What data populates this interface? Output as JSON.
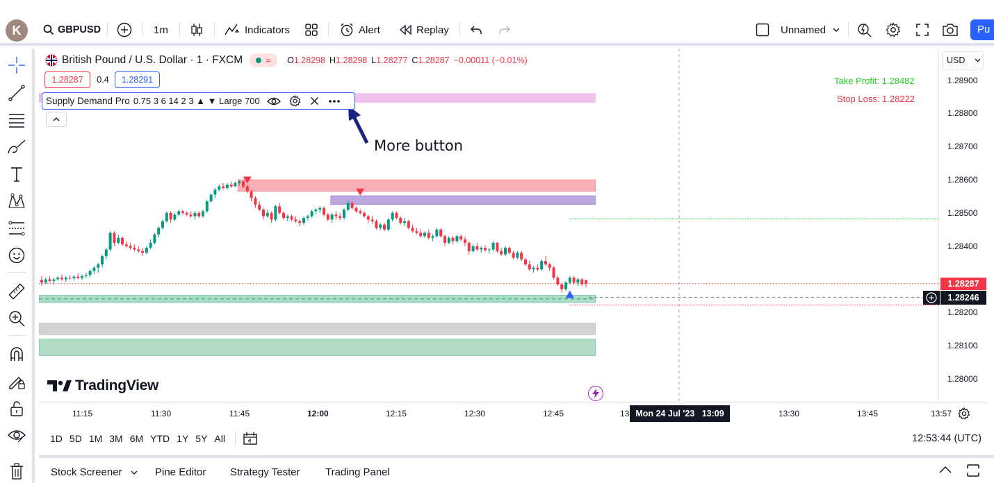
{
  "toolbar": {
    "avatar_letter": "K",
    "symbol": "GBPUSD",
    "interval": "1m",
    "indicators_label": "Indicators",
    "alert_label": "Alert",
    "replay_label": "Replay",
    "layout_name": "Unnamed",
    "publish_label": "Pu"
  },
  "legend": {
    "title": "British Pound / U.S. Dollar · 1 · FXCM",
    "open_label": "O",
    "open": "1.28298",
    "high_label": "H",
    "high": "1.28298",
    "low_label": "L",
    "low": "1.28277",
    "close_label": "C",
    "close": "1.28287",
    "change": "−0.00011 (−0.01%)",
    "bid": "1.28287",
    "spread": "0.4",
    "ask": "1.28291"
  },
  "indicator": {
    "name": "Supply Demand Pro",
    "params": "0.75 3 6 14 2 3 ▲ ▼ Large 700"
  },
  "annotation": {
    "more_button_label": "More button"
  },
  "overlay": {
    "take_profit": "Take Profit: 1.28482",
    "stop_loss": "Stop Loss: 1.28222",
    "watermark": "TradingView"
  },
  "price_scale": {
    "currency": "USD",
    "labels": [
      "1.28900",
      "1.28800",
      "1.28700",
      "1.28600",
      "1.28500",
      "1.28400",
      "1.28200",
      "1.28100",
      "1.28000"
    ],
    "last_price": "1.28287",
    "crosshair_price": "1.28246"
  },
  "time_scale": {
    "labels": [
      "11:15",
      "11:30",
      "11:45",
      "12:00",
      "12:15",
      "12:30",
      "12:45",
      "13",
      "13:30",
      "13:45",
      "13:57"
    ],
    "crosshair_time": "Mon 24 Jul '23   13:09"
  },
  "range_bar": {
    "ranges": [
      "1D",
      "5D",
      "1M",
      "3M",
      "6M",
      "YTD",
      "1Y",
      "5Y",
      "All"
    ],
    "clock": "12:53:44 (UTC)"
  },
  "bottom_tabs": [
    "Stock Screener",
    "Pine Editor",
    "Strategy Tester",
    "Trading Panel"
  ],
  "colors": {
    "bull": "#089981",
    "bear": "#f23645",
    "accent": "#2962ff",
    "supply_zone": "#f7a1a9",
    "purple_zone": "#b39ddb",
    "demand_zone": "#a5d6b8",
    "neutral_zone": "#c9cacd",
    "pink_zone": "#f0b6ea"
  },
  "chart_data": {
    "type": "candlestick",
    "interval": "1m",
    "ylim": [
      1.2797,
      1.2895
    ],
    "candles": [
      {
        "o": 1.28298,
        "h": 1.2831,
        "l": 1.2828,
        "c": 1.2829
      },
      {
        "o": 1.2829,
        "h": 1.28305,
        "l": 1.28285,
        "c": 1.283
      },
      {
        "o": 1.283,
        "h": 1.2831,
        "l": 1.2829,
        "c": 1.28295
      },
      {
        "o": 1.28295,
        "h": 1.28305,
        "l": 1.28285,
        "c": 1.283
      },
      {
        "o": 1.283,
        "h": 1.2831,
        "l": 1.28295,
        "c": 1.28305
      },
      {
        "o": 1.28305,
        "h": 1.28315,
        "l": 1.28295,
        "c": 1.283
      },
      {
        "o": 1.283,
        "h": 1.2831,
        "l": 1.28292,
        "c": 1.28305
      },
      {
        "o": 1.28305,
        "h": 1.28312,
        "l": 1.28298,
        "c": 1.28303
      },
      {
        "o": 1.28303,
        "h": 1.28312,
        "l": 1.28296,
        "c": 1.28308
      },
      {
        "o": 1.28308,
        "h": 1.28318,
        "l": 1.283,
        "c": 1.28304
      },
      {
        "o": 1.28304,
        "h": 1.28314,
        "l": 1.28298,
        "c": 1.2831
      },
      {
        "o": 1.2831,
        "h": 1.2832,
        "l": 1.28303,
        "c": 1.28313
      },
      {
        "o": 1.28313,
        "h": 1.2833,
        "l": 1.28305,
        "c": 1.28325
      },
      {
        "o": 1.28325,
        "h": 1.2834,
        "l": 1.28315,
        "c": 1.28335
      },
      {
        "o": 1.28335,
        "h": 1.2835,
        "l": 1.2832,
        "c": 1.28345
      },
      {
        "o": 1.28345,
        "h": 1.28375,
        "l": 1.28335,
        "c": 1.2837
      },
      {
        "o": 1.2837,
        "h": 1.28395,
        "l": 1.2836,
        "c": 1.2839
      },
      {
        "o": 1.2839,
        "h": 1.28445,
        "l": 1.28385,
        "c": 1.2844
      },
      {
        "o": 1.2844,
        "h": 1.28445,
        "l": 1.284,
        "c": 1.2841
      },
      {
        "o": 1.2841,
        "h": 1.28435,
        "l": 1.28405,
        "c": 1.28425
      },
      {
        "o": 1.28425,
        "h": 1.2843,
        "l": 1.284,
        "c": 1.28405
      },
      {
        "o": 1.28405,
        "h": 1.28415,
        "l": 1.28395,
        "c": 1.284
      },
      {
        "o": 1.284,
        "h": 1.2841,
        "l": 1.2839,
        "c": 1.28395
      },
      {
        "o": 1.28395,
        "h": 1.28405,
        "l": 1.28385,
        "c": 1.2839
      },
      {
        "o": 1.2839,
        "h": 1.284,
        "l": 1.2838,
        "c": 1.28385
      },
      {
        "o": 1.28385,
        "h": 1.28395,
        "l": 1.2837,
        "c": 1.2838
      },
      {
        "o": 1.2838,
        "h": 1.284,
        "l": 1.28375,
        "c": 1.28395
      },
      {
        "o": 1.28395,
        "h": 1.2842,
        "l": 1.2839,
        "c": 1.2841
      },
      {
        "o": 1.2841,
        "h": 1.2844,
        "l": 1.28405,
        "c": 1.28435
      },
      {
        "o": 1.28435,
        "h": 1.2846,
        "l": 1.28425,
        "c": 1.28455
      },
      {
        "o": 1.28455,
        "h": 1.2848,
        "l": 1.2845,
        "c": 1.28475
      },
      {
        "o": 1.28475,
        "h": 1.28505,
        "l": 1.2847,
        "c": 1.285
      },
      {
        "o": 1.285,
        "h": 1.28505,
        "l": 1.2847,
        "c": 1.2848
      },
      {
        "o": 1.2848,
        "h": 1.285,
        "l": 1.28475,
        "c": 1.28495
      },
      {
        "o": 1.28495,
        "h": 1.2851,
        "l": 1.2849,
        "c": 1.28505
      },
      {
        "o": 1.28505,
        "h": 1.2851,
        "l": 1.28495,
        "c": 1.285
      },
      {
        "o": 1.285,
        "h": 1.28505,
        "l": 1.2849,
        "c": 1.28495
      },
      {
        "o": 1.28495,
        "h": 1.28505,
        "l": 1.28485,
        "c": 1.2849
      },
      {
        "o": 1.2849,
        "h": 1.28505,
        "l": 1.2848,
        "c": 1.285
      },
      {
        "o": 1.285,
        "h": 1.28505,
        "l": 1.28485,
        "c": 1.2849
      },
      {
        "o": 1.2849,
        "h": 1.2851,
        "l": 1.28485,
        "c": 1.28505
      },
      {
        "o": 1.28505,
        "h": 1.2854,
        "l": 1.285,
        "c": 1.28535
      },
      {
        "o": 1.28535,
        "h": 1.2856,
        "l": 1.2853,
        "c": 1.28555
      },
      {
        "o": 1.28555,
        "h": 1.28575,
        "l": 1.28545,
        "c": 1.2857
      },
      {
        "o": 1.2857,
        "h": 1.28585,
        "l": 1.28565,
        "c": 1.2858
      },
      {
        "o": 1.2858,
        "h": 1.2859,
        "l": 1.2857,
        "c": 1.28575
      },
      {
        "o": 1.28575,
        "h": 1.2859,
        "l": 1.2857,
        "c": 1.28585
      },
      {
        "o": 1.28585,
        "h": 1.28595,
        "l": 1.28575,
        "c": 1.2858
      },
      {
        "o": 1.2858,
        "h": 1.28595,
        "l": 1.28578,
        "c": 1.2859
      },
      {
        "o": 1.2859,
        "h": 1.286,
        "l": 1.28582,
        "c": 1.28595
      },
      {
        "o": 1.28595,
        "h": 1.28598,
        "l": 1.28575,
        "c": 1.2858
      },
      {
        "o": 1.2858,
        "h": 1.28585,
        "l": 1.2856,
        "c": 1.28565
      },
      {
        "o": 1.28565,
        "h": 1.2857,
        "l": 1.28535,
        "c": 1.28545
      },
      {
        "o": 1.28545,
        "h": 1.2855,
        "l": 1.28515,
        "c": 1.28525
      },
      {
        "o": 1.28525,
        "h": 1.28535,
        "l": 1.28505,
        "c": 1.2851
      },
      {
        "o": 1.2851,
        "h": 1.28515,
        "l": 1.2848,
        "c": 1.2849
      },
      {
        "o": 1.2849,
        "h": 1.2851,
        "l": 1.28485,
        "c": 1.285
      },
      {
        "o": 1.285,
        "h": 1.28505,
        "l": 1.2847,
        "c": 1.2848
      },
      {
        "o": 1.2848,
        "h": 1.28525,
        "l": 1.28475,
        "c": 1.2852
      },
      {
        "o": 1.2852,
        "h": 1.2853,
        "l": 1.28495,
        "c": 1.285
      },
      {
        "o": 1.285,
        "h": 1.28505,
        "l": 1.2848,
        "c": 1.28485
      },
      {
        "o": 1.28485,
        "h": 1.28495,
        "l": 1.28475,
        "c": 1.2849
      },
      {
        "o": 1.2849,
        "h": 1.28495,
        "l": 1.28475,
        "c": 1.2848
      },
      {
        "o": 1.2848,
        "h": 1.2849,
        "l": 1.2847,
        "c": 1.28475
      },
      {
        "o": 1.28475,
        "h": 1.2848,
        "l": 1.2846,
        "c": 1.2847
      },
      {
        "o": 1.2847,
        "h": 1.2849,
        "l": 1.28465,
        "c": 1.28485
      },
      {
        "o": 1.28485,
        "h": 1.28495,
        "l": 1.28478,
        "c": 1.2849
      },
      {
        "o": 1.2849,
        "h": 1.2851,
        "l": 1.28485,
        "c": 1.28505
      },
      {
        "o": 1.28505,
        "h": 1.28515,
        "l": 1.28495,
        "c": 1.2851
      },
      {
        "o": 1.2851,
        "h": 1.2852,
        "l": 1.285,
        "c": 1.28515
      },
      {
        "o": 1.28515,
        "h": 1.2852,
        "l": 1.2849,
        "c": 1.28495
      },
      {
        "o": 1.28495,
        "h": 1.285,
        "l": 1.28475,
        "c": 1.2848
      },
      {
        "o": 1.2848,
        "h": 1.285,
        "l": 1.2847,
        "c": 1.28495
      },
      {
        "o": 1.28495,
        "h": 1.28505,
        "l": 1.2848,
        "c": 1.2849
      },
      {
        "o": 1.2849,
        "h": 1.285,
        "l": 1.28478,
        "c": 1.28485
      },
      {
        "o": 1.28485,
        "h": 1.28515,
        "l": 1.2848,
        "c": 1.2851
      },
      {
        "o": 1.2851,
        "h": 1.28535,
        "l": 1.28505,
        "c": 1.2853
      },
      {
        "o": 1.2853,
        "h": 1.28535,
        "l": 1.2851,
        "c": 1.28515
      },
      {
        "o": 1.28515,
        "h": 1.2852,
        "l": 1.285,
        "c": 1.28505
      },
      {
        "o": 1.28505,
        "h": 1.28512,
        "l": 1.28495,
        "c": 1.285
      },
      {
        "o": 1.285,
        "h": 1.28505,
        "l": 1.28485,
        "c": 1.2849
      },
      {
        "o": 1.2849,
        "h": 1.28495,
        "l": 1.2847,
        "c": 1.2848
      },
      {
        "o": 1.2848,
        "h": 1.2849,
        "l": 1.28468,
        "c": 1.28475
      },
      {
        "o": 1.28475,
        "h": 1.2848,
        "l": 1.2845,
        "c": 1.28455
      },
      {
        "o": 1.28455,
        "h": 1.2847,
        "l": 1.28448,
        "c": 1.28465
      },
      {
        "o": 1.28465,
        "h": 1.2847,
        "l": 1.28445,
        "c": 1.2845
      },
      {
        "o": 1.2845,
        "h": 1.28485,
        "l": 1.28445,
        "c": 1.2848
      },
      {
        "o": 1.2848,
        "h": 1.28505,
        "l": 1.28475,
        "c": 1.285
      },
      {
        "o": 1.285,
        "h": 1.28505,
        "l": 1.2848,
        "c": 1.28485
      },
      {
        "o": 1.28485,
        "h": 1.2849,
        "l": 1.28465,
        "c": 1.2847
      },
      {
        "o": 1.2847,
        "h": 1.28485,
        "l": 1.2846,
        "c": 1.28475
      },
      {
        "o": 1.28475,
        "h": 1.2848,
        "l": 1.2845,
        "c": 1.28455
      },
      {
        "o": 1.28455,
        "h": 1.28465,
        "l": 1.2844,
        "c": 1.28445
      },
      {
        "o": 1.28445,
        "h": 1.28455,
        "l": 1.28435,
        "c": 1.2844
      },
      {
        "o": 1.2844,
        "h": 1.2845,
        "l": 1.28425,
        "c": 1.2843
      },
      {
        "o": 1.2843,
        "h": 1.28445,
        "l": 1.28425,
        "c": 1.2844
      },
      {
        "o": 1.2844,
        "h": 1.2845,
        "l": 1.2842,
        "c": 1.28425
      },
      {
        "o": 1.28425,
        "h": 1.28435,
        "l": 1.28415,
        "c": 1.2843
      },
      {
        "o": 1.2843,
        "h": 1.28455,
        "l": 1.28425,
        "c": 1.2845
      },
      {
        "o": 1.2845,
        "h": 1.28455,
        "l": 1.28425,
        "c": 1.2843
      },
      {
        "o": 1.2843,
        "h": 1.28435,
        "l": 1.284,
        "c": 1.2841
      },
      {
        "o": 1.2841,
        "h": 1.2843,
        "l": 1.28405,
        "c": 1.28425
      },
      {
        "o": 1.28425,
        "h": 1.2843,
        "l": 1.28405,
        "c": 1.28415
      },
      {
        "o": 1.28415,
        "h": 1.28435,
        "l": 1.2841,
        "c": 1.2843
      },
      {
        "o": 1.2843,
        "h": 1.28435,
        "l": 1.28415,
        "c": 1.2842
      },
      {
        "o": 1.2842,
        "h": 1.28428,
        "l": 1.284,
        "c": 1.2841
      },
      {
        "o": 1.2841,
        "h": 1.28415,
        "l": 1.28375,
        "c": 1.28385
      },
      {
        "o": 1.28385,
        "h": 1.28405,
        "l": 1.2838,
        "c": 1.284
      },
      {
        "o": 1.284,
        "h": 1.2841,
        "l": 1.28385,
        "c": 1.2839
      },
      {
        "o": 1.2839,
        "h": 1.284,
        "l": 1.2838,
        "c": 1.28395
      },
      {
        "o": 1.28395,
        "h": 1.28402,
        "l": 1.28382,
        "c": 1.28388
      },
      {
        "o": 1.28388,
        "h": 1.28395,
        "l": 1.28378,
        "c": 1.2839
      },
      {
        "o": 1.2839,
        "h": 1.28415,
        "l": 1.28385,
        "c": 1.2841
      },
      {
        "o": 1.2841,
        "h": 1.28412,
        "l": 1.2838,
        "c": 1.28385
      },
      {
        "o": 1.28385,
        "h": 1.28395,
        "l": 1.2837,
        "c": 1.28375
      },
      {
        "o": 1.28375,
        "h": 1.284,
        "l": 1.2837,
        "c": 1.28395
      },
      {
        "o": 1.28395,
        "h": 1.284,
        "l": 1.28375,
        "c": 1.2838
      },
      {
        "o": 1.2838,
        "h": 1.28385,
        "l": 1.2836,
        "c": 1.28365
      },
      {
        "o": 1.28365,
        "h": 1.28385,
        "l": 1.2836,
        "c": 1.2838
      },
      {
        "o": 1.2838,
        "h": 1.28385,
        "l": 1.28355,
        "c": 1.2836
      },
      {
        "o": 1.2836,
        "h": 1.28365,
        "l": 1.2834,
        "c": 1.28345
      },
      {
        "o": 1.28345,
        "h": 1.28355,
        "l": 1.28325,
        "c": 1.2833
      },
      {
        "o": 1.2833,
        "h": 1.2834,
        "l": 1.2832,
        "c": 1.28335
      },
      {
        "o": 1.28335,
        "h": 1.28345,
        "l": 1.28325,
        "c": 1.2833
      },
      {
        "o": 1.2833,
        "h": 1.2836,
        "l": 1.28325,
        "c": 1.28355
      },
      {
        "o": 1.28355,
        "h": 1.2837,
        "l": 1.2834,
        "c": 1.28345
      },
      {
        "o": 1.28345,
        "h": 1.2835,
        "l": 1.28325,
        "c": 1.28335
      },
      {
        "o": 1.28335,
        "h": 1.2834,
        "l": 1.283,
        "c": 1.28305
      },
      {
        "o": 1.28305,
        "h": 1.2831,
        "l": 1.2828,
        "c": 1.28285
      },
      {
        "o": 1.28285,
        "h": 1.2829,
        "l": 1.2826,
        "c": 1.2827
      },
      {
        "o": 1.2827,
        "h": 1.28295,
        "l": 1.28265,
        "c": 1.2829
      },
      {
        "o": 1.2829,
        "h": 1.2831,
        "l": 1.28285,
        "c": 1.28305
      },
      {
        "o": 1.28305,
        "h": 1.2831,
        "l": 1.28285,
        "c": 1.2829
      },
      {
        "o": 1.2829,
        "h": 1.28305,
        "l": 1.2828,
        "c": 1.283
      },
      {
        "o": 1.283,
        "h": 1.28305,
        "l": 1.2828,
        "c": 1.28285
      },
      {
        "o": 1.28298,
        "h": 1.28298,
        "l": 1.28277,
        "c": 1.28287
      }
    ],
    "zones": [
      {
        "kind": "pink",
        "start": 0,
        "end": 137,
        "bottom": 1.28833,
        "top": 1.2886
      },
      {
        "kind": "supply",
        "start": 49,
        "end": 137,
        "bottom": 1.28565,
        "top": 1.286
      },
      {
        "kind": "purple",
        "start": 72,
        "end": 137,
        "bottom": 1.28525,
        "top": 1.28552
      },
      {
        "kind": "demand",
        "start": 0,
        "end": 137,
        "bottom": 1.2823,
        "top": 1.28252
      },
      {
        "kind": "neutral",
        "start": 0,
        "end": 137,
        "bottom": 1.28133,
        "top": 1.28168
      },
      {
        "kind": "demand",
        "start": 0,
        "end": 137,
        "bottom": 1.2807,
        "top": 1.2812
      }
    ],
    "take_profit": 1.28482,
    "stop_loss": 1.28222,
    "last_price": 1.28287,
    "crosshair_price": 1.28246
  }
}
